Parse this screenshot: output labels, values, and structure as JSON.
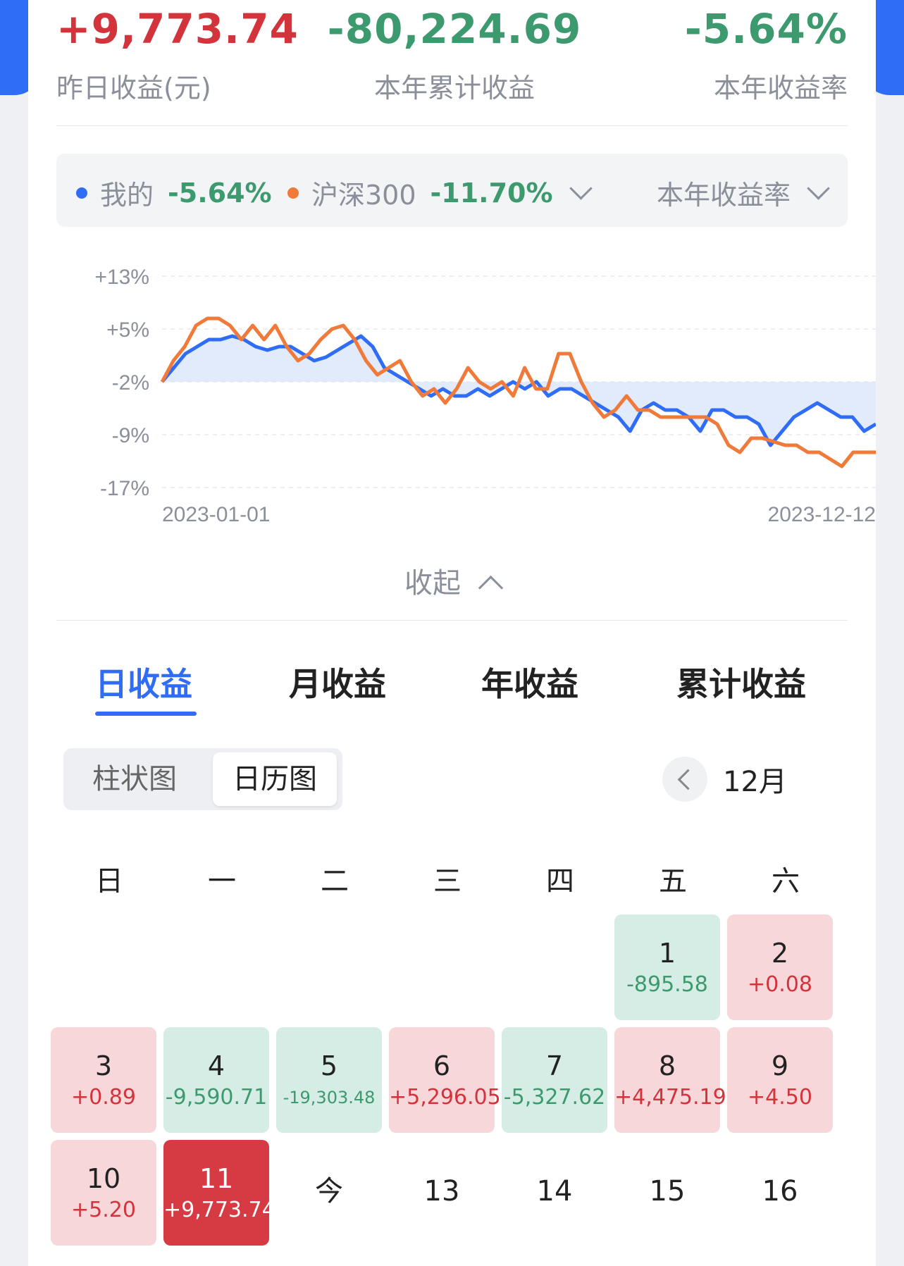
{
  "summary": {
    "yesterday_value": "+9,773.74",
    "yesterday_label": "昨日收益(元)",
    "ytd_value": "-80,224.69",
    "ytd_label": "本年累计收益",
    "rate_value": "-5.64%",
    "rate_label": "本年收益率"
  },
  "legend": {
    "mine_label": "我的",
    "mine_pct": "-5.64%",
    "bench_label": "沪深300",
    "bench_pct": "-11.70%",
    "metric_label": "本年收益率",
    "colors": {
      "mine": "#2f6df6",
      "bench": "#f07a3a"
    }
  },
  "chart_data": {
    "type": "line",
    "y_ticks": [
      "+13%",
      "+5%",
      "-2%",
      "-9%",
      "-17%"
    ],
    "ylim": [
      -17,
      13
    ],
    "x_start": "2023-01-01",
    "x_end": "2023-12-12",
    "series": [
      {
        "name": "我的",
        "color": "#2f6df6",
        "values": [
          -2,
          0,
          2,
          3,
          4,
          4,
          4.5,
          4,
          3,
          2.5,
          3,
          3,
          2,
          1,
          1.5,
          2.5,
          3.5,
          4.5,
          3,
          0,
          -1,
          -2,
          -3,
          -4,
          -3,
          -4,
          -4,
          -3,
          -4,
          -3,
          -2,
          -3,
          -2,
          -4,
          -3,
          -3,
          -4,
          -5,
          -6,
          -7,
          -9,
          -6,
          -5,
          -6,
          -6,
          -7,
          -9,
          -6,
          -6,
          -7,
          -7,
          -8,
          -11,
          -9,
          -7,
          -6,
          -5,
          -6,
          -7,
          -7,
          -9,
          -8
        ]
      },
      {
        "name": "沪深300",
        "color": "#f07a3a",
        "values": [
          -2,
          1,
          3,
          6,
          7,
          7,
          6,
          4,
          6,
          4,
          6,
          3,
          1,
          2,
          4,
          5.5,
          6,
          4,
          1,
          -1,
          0,
          1,
          -2,
          -4,
          -3,
          -5,
          -3,
          0,
          -2,
          -3,
          -2,
          -4,
          0,
          -3,
          -3,
          2,
          2,
          -2,
          -5,
          -7,
          -6,
          -4,
          -6,
          -6,
          -7,
          -7,
          -7,
          -7,
          -7,
          -8,
          -11,
          -12,
          -10,
          -10,
          -10.5,
          -11,
          -11,
          -12,
          -12,
          -13,
          -14,
          -12,
          -12,
          -12
        ]
      }
    ]
  },
  "collapse_label": "收起",
  "tabs": [
    "日收益",
    "月收益",
    "年收益",
    "累计收益"
  ],
  "view_toggle": {
    "bar": "柱状图",
    "calendar": "日历图"
  },
  "month": "12月",
  "weekdays": [
    "日",
    "一",
    "二",
    "三",
    "四",
    "五",
    "六"
  ],
  "calendar": [
    {
      "day": "1",
      "value": "-895.58",
      "kind": "neg"
    },
    {
      "day": "2",
      "value": "+0.08",
      "kind": "pos"
    },
    {
      "day": "3",
      "value": "+0.89",
      "kind": "pos"
    },
    {
      "day": "4",
      "value": "-9,590.71",
      "kind": "neg"
    },
    {
      "day": "5",
      "value": "-19,303.48",
      "kind": "neg"
    },
    {
      "day": "6",
      "value": "+5,296.05",
      "kind": "pos"
    },
    {
      "day": "7",
      "value": "-5,327.62",
      "kind": "neg"
    },
    {
      "day": "8",
      "value": "+4,475.19",
      "kind": "pos"
    },
    {
      "day": "9",
      "value": "+4.50",
      "kind": "pos"
    },
    {
      "day": "10",
      "value": "+5.20",
      "kind": "pos"
    },
    {
      "day": "11",
      "value": "+9,773.74",
      "kind": "highlight"
    },
    {
      "day": "今",
      "value": "",
      "kind": "empty"
    },
    {
      "day": "13",
      "value": "",
      "kind": "empty"
    },
    {
      "day": "14",
      "value": "",
      "kind": "empty"
    },
    {
      "day": "15",
      "value": "",
      "kind": "empty"
    },
    {
      "day": "16",
      "value": "",
      "kind": "empty"
    }
  ]
}
